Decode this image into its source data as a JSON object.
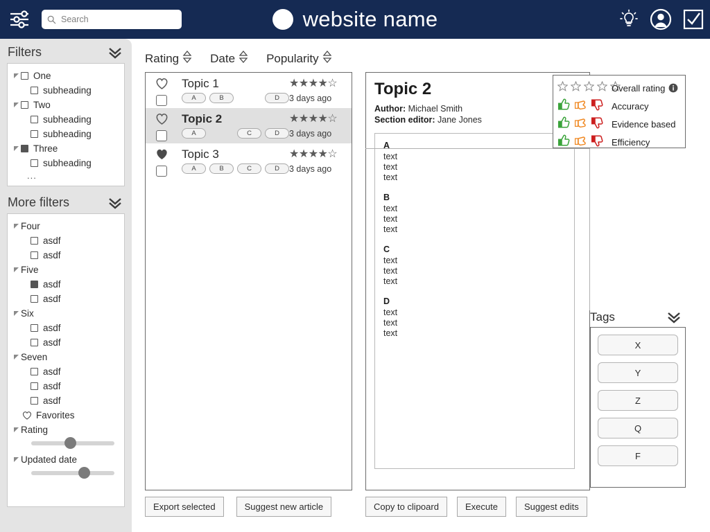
{
  "header": {
    "settings_icon": "sliders-icon",
    "search": {
      "placeholder": "Search",
      "value": ""
    },
    "brand_name": "website name",
    "icons": [
      "lightbulb-icon",
      "account-icon",
      "checkbox-icon"
    ]
  },
  "sidebar": {
    "filters": {
      "title": "Filters",
      "collapse_icon": "chevron-double-down-icon",
      "groups": [
        {
          "label": "One",
          "checked": false,
          "children": [
            {
              "label": "subheading",
              "checked": false
            }
          ]
        },
        {
          "label": "Two",
          "checked": false,
          "children": [
            {
              "label": "subheading",
              "checked": false
            },
            {
              "label": "subheading",
              "checked": false
            }
          ]
        },
        {
          "label": "Three",
          "checked": true,
          "children": [
            {
              "label": "subheading",
              "checked": false
            }
          ]
        }
      ],
      "more_indicator": "..."
    },
    "more_filters": {
      "title": "More filters",
      "collapse_icon": "chevron-double-down-icon",
      "groups": [
        {
          "label": "Four",
          "children": [
            {
              "label": "asdf",
              "checked": false
            },
            {
              "label": "asdf",
              "checked": false
            }
          ]
        },
        {
          "label": "Five",
          "children": [
            {
              "label": "asdf",
              "checked": true
            },
            {
              "label": "asdf",
              "checked": false
            }
          ]
        },
        {
          "label": "Six",
          "children": [
            {
              "label": "asdf",
              "checked": false
            },
            {
              "label": "asdf",
              "checked": false
            }
          ]
        },
        {
          "label": "Seven",
          "children": [
            {
              "label": "asdf",
              "checked": false
            },
            {
              "label": "asdf",
              "checked": false
            },
            {
              "label": "asdf",
              "checked": false
            }
          ]
        }
      ],
      "favorites_label": "Favorites",
      "sliders": [
        {
          "label": "Rating",
          "position_pct": 40
        },
        {
          "label": "Updated date",
          "position_pct": 57
        }
      ]
    }
  },
  "sort": {
    "items": [
      {
        "label": "Rating",
        "icon": "sort-updown-icon"
      },
      {
        "label": "Date",
        "icon": "sort-updown-icon"
      },
      {
        "label": "Popularity",
        "icon": "sort-updown-icon"
      }
    ]
  },
  "list": {
    "rows": [
      {
        "title": "Topic 1",
        "favorite": false,
        "selected": false,
        "checked": false,
        "tags": [
          "A",
          "B",
          "",
          "D"
        ],
        "stars": 4.5,
        "stars_text": "★★★★☆",
        "ago": "3 days ago"
      },
      {
        "title": "Topic 2",
        "favorite": false,
        "selected": true,
        "checked": false,
        "tags": [
          "A",
          "",
          "C",
          "D"
        ],
        "stars": 4.5,
        "stars_text": "★★★★☆",
        "ago": "3 days ago"
      },
      {
        "title": "Topic 3",
        "favorite": true,
        "selected": false,
        "checked": false,
        "tags": [
          "A",
          "B",
          "C",
          "D"
        ],
        "stars": 4.5,
        "stars_text": "★★★★☆",
        "ago": "3 days ago"
      }
    ]
  },
  "detail": {
    "title": "Topic 2",
    "author_label": "Author:",
    "author": "Michael Smith",
    "editor_label": "Section editor:",
    "editor": "Jane Jones",
    "sections": [
      {
        "heading": "A",
        "lines": [
          "text",
          "text",
          "text"
        ]
      },
      {
        "heading": "B",
        "lines": [
          "text",
          "text",
          "text"
        ]
      },
      {
        "heading": "C",
        "lines": [
          "text",
          "text",
          "text"
        ]
      },
      {
        "heading": "D",
        "lines": [
          "text",
          "text",
          "text"
        ]
      }
    ]
  },
  "ratings": {
    "overall": {
      "label": "Overall rating",
      "stars_filled": 0,
      "stars_total": 5,
      "info_icon": "info-icon"
    },
    "criteria": [
      {
        "label": "Accuracy",
        "icons": [
          "thumb-up-icon",
          "thumb-side-icon",
          "thumb-down-icon"
        ]
      },
      {
        "label": "Evidence based",
        "icons": [
          "thumb-up-icon",
          "thumb-side-icon",
          "thumb-down-icon"
        ]
      },
      {
        "label": "Efficiency",
        "icons": [
          "thumb-up-icon",
          "thumb-side-icon",
          "thumb-down-icon"
        ]
      }
    ],
    "colors": {
      "up": "#3aa33a",
      "side": "#f08a25",
      "down": "#cc1f1f"
    }
  },
  "tags": {
    "title": "Tags",
    "collapse_icon": "chevron-double-down-icon",
    "items": [
      "X",
      "Y",
      "Z",
      "Q",
      "F"
    ]
  },
  "actions": {
    "left": [
      "Export selected",
      "Suggest new article"
    ],
    "right": [
      "Copy to clipoard",
      "Execute",
      "Suggest edits"
    ]
  }
}
